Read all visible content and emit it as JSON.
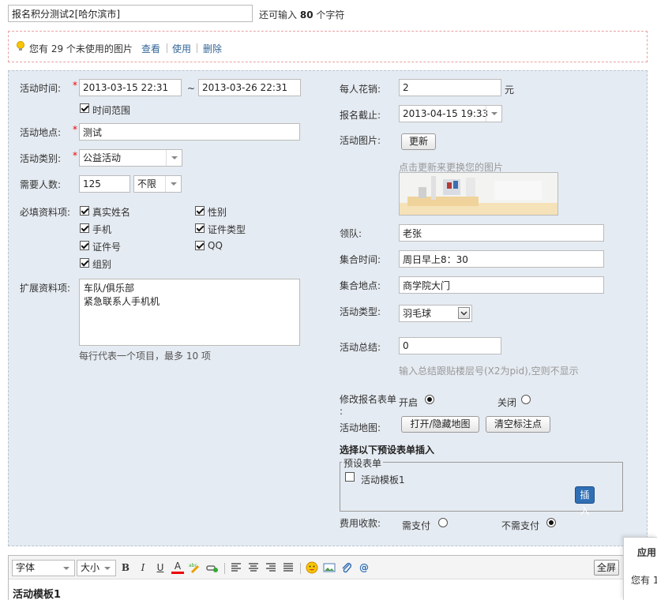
{
  "header": {
    "title_value": "报名积分测试2[哈尔滨市]",
    "char_hint_prefix": "还可输入",
    "char_count": "80",
    "char_hint_suffix": "个字符"
  },
  "notice": {
    "text": "您有 29 个未使用的图片",
    "view": "查看",
    "use": "使用",
    "delete": "删除"
  },
  "left": {
    "time_label": "活动时间:",
    "time_start": "2013-03-15 22:31",
    "time_sep": "~",
    "time_end": "2013-03-26 22:31",
    "time_range_label": "时间范围",
    "place_label": "活动地点:",
    "place_value": "测试",
    "category_label": "活动类别:",
    "category_value": "公益活动",
    "people_label": "需要人数:",
    "people_value": "125",
    "people_limit": "不限",
    "required_label": "必填资料项:",
    "fields": {
      "real_name": "真实姓名",
      "gender": "性别",
      "mobile": "手机",
      "id_type": "证件类型",
      "id_number": "证件号",
      "qq": "QQ",
      "group": "组别"
    },
    "ext_label": "扩展资料项:",
    "ext_line1": "车队/俱乐部",
    "ext_line2": "紧急联系人手机机",
    "ext_hint": "每行代表一个项目，最多 10 项"
  },
  "right": {
    "cost_label": "每人花销:",
    "cost_value": "2",
    "cost_unit": "元",
    "deadline_label": "报名截止:",
    "deadline_value": "2013-04-15 19:33",
    "image_label": "活动图片:",
    "update_button": "更新",
    "image_hint": "点击更新来更换您的图片",
    "leader_label": "领队:",
    "leader_value": "老张",
    "meet_time_label": "集合时间:",
    "meet_time_value": "周日早上8：30",
    "meet_place_label": "集合地点:",
    "meet_place_value": "商学院大门",
    "type_label": "活动类型:",
    "type_value": "羽毛球",
    "summary_label": "活动总结:",
    "summary_value": "0",
    "summary_hint": "输入总结跟贴楼层号(X2为pid),空则不显示",
    "modify_label": "修改报名表单",
    "modify_colon": ":",
    "open_label": "开启",
    "close_label": "关闭",
    "map_label": "活动地图:",
    "map_toggle": "打开/隐藏地图",
    "map_clear": "清空标注点",
    "preset_title": "选择以下预设表单插入",
    "preset_legend": "预设表单",
    "preset_item": "活动模板1",
    "insert_button": "插入",
    "fee_label": "费用收款:",
    "fee_need": "需支付",
    "fee_none": "不需支付"
  },
  "editor": {
    "font": "字体",
    "size": "大小",
    "fullscreen": "全屏",
    "content_title": "活动模板1"
  },
  "side_panel": {
    "title": "应用",
    "text": "您有 1"
  },
  "colors": {
    "form_bg": "#e5ebf2",
    "link": "#336699",
    "required": "#e00000",
    "insert_button": "#2f6fb5"
  }
}
